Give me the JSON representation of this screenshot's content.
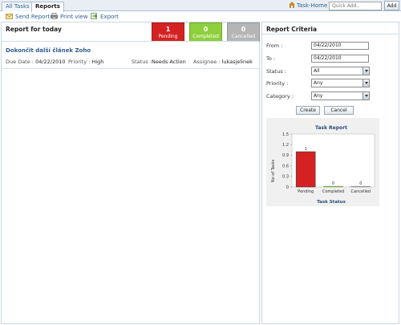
{
  "tabs": [
    {
      "label": "All Tasks"
    },
    {
      "label": "Reports"
    }
  ],
  "header": {
    "task_home": "Task-Home",
    "quick_add_placeholder": "Quick Add..",
    "add_label": "Add"
  },
  "toolbar": {
    "send_report": "Send Report",
    "print_view": "Print view",
    "export": "Export"
  },
  "report": {
    "title": "Report for today",
    "counts": [
      {
        "count": "1",
        "label": "Pending",
        "color": "#d42222"
      },
      {
        "count": "0",
        "label": "Completed",
        "color": "#8ecf3c"
      },
      {
        "count": "0",
        "label": "Cancelled",
        "color": "#b5b5b5"
      }
    ],
    "task": {
      "title": "Dokončit další článek Zoho",
      "due_date_label": "Due Date :",
      "due_date": "04/22/2010",
      "priority_label": "Priority :",
      "priority": "High",
      "status_label": "Status :",
      "status": "Needs Action",
      "assignee_label": "Assignee :",
      "assignee": "lukasjelinek"
    }
  },
  "criteria": {
    "title": "Report Criteria",
    "from_label": "From :",
    "from_value": "04/22/2010",
    "to_label": "To :",
    "to_value": "04/22/2010",
    "status_label": "Status :",
    "status_value": "All",
    "priority_label": "Priority :",
    "priority_value": "Any",
    "category_label": "Category :",
    "category_value": "Any",
    "create_label": "Create",
    "cancel_label": "Cancel"
  },
  "chart_data": {
    "type": "bar",
    "title": "Task Report",
    "xlabel": "Task Status",
    "ylabel": "No of Tasks",
    "categories": [
      "Pending",
      "Completed",
      "Cancelled"
    ],
    "values": [
      1,
      0,
      0
    ],
    "data_labels": [
      "1",
      "0",
      "0"
    ],
    "colors": [
      "#d42222",
      "#8ecf3c",
      "#b5b5b5"
    ],
    "ylim": [
      0,
      1.5
    ],
    "yticks": [
      "0",
      "0.3",
      "0.6",
      "0.9",
      "1.2",
      "1.5"
    ],
    "grid": false,
    "legend": "none"
  }
}
